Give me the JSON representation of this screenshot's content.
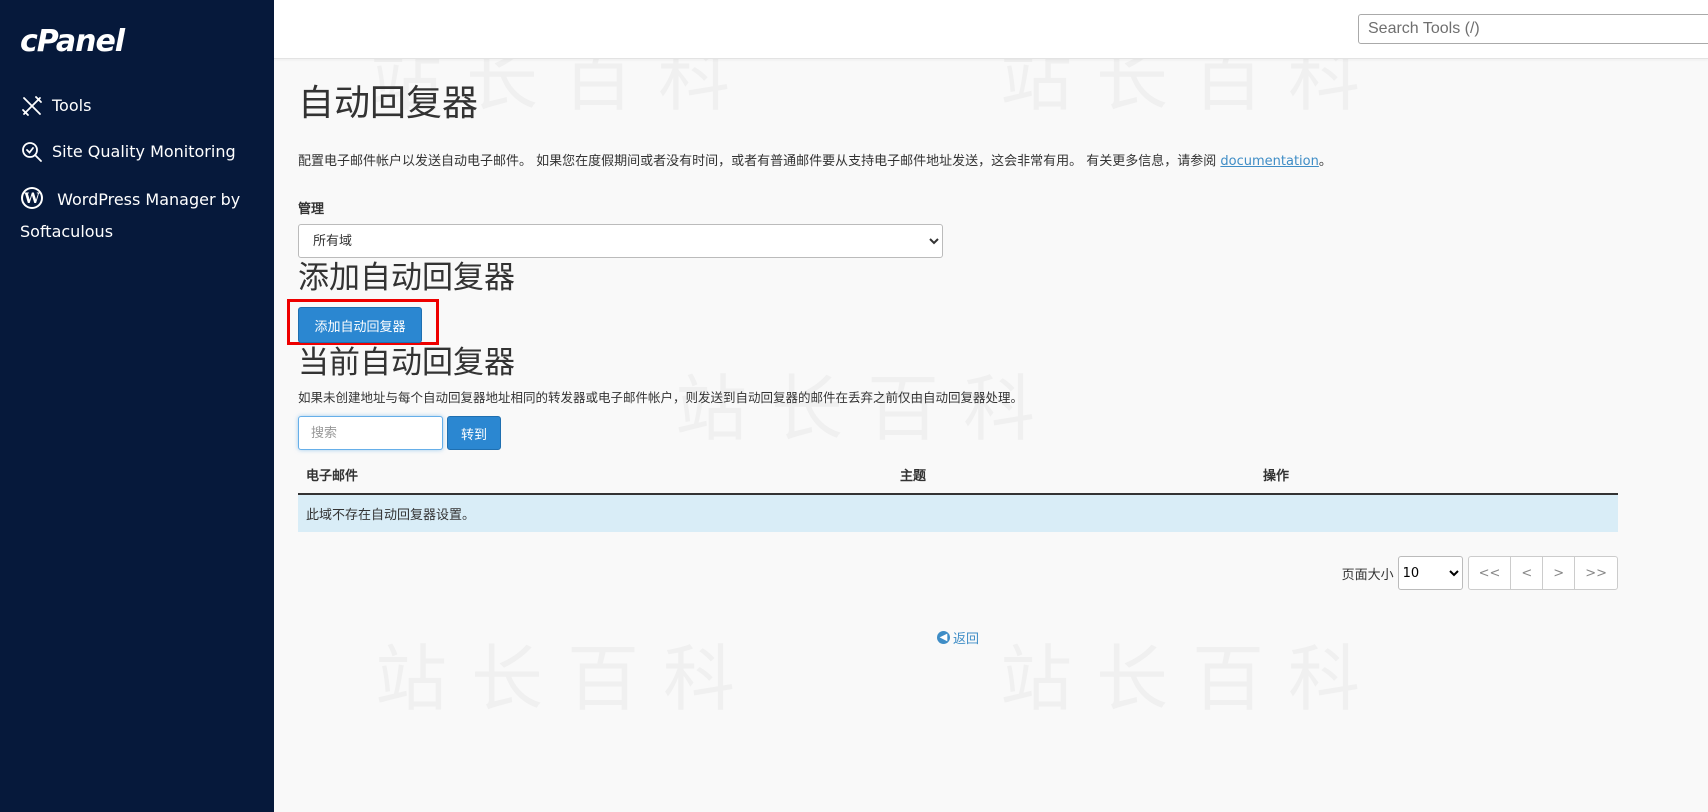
{
  "sidebar": {
    "logo": "cPanel",
    "items": [
      {
        "label": "Tools",
        "icon": "tools-icon"
      },
      {
        "label": "Site Quality Monitoring",
        "icon": "magnifier-check-icon"
      },
      {
        "label": "WordPress Manager by Softaculous",
        "icon": "wordpress-icon"
      }
    ]
  },
  "header": {
    "search_placeholder": "Search Tools (/)"
  },
  "main": {
    "title": "自动回复器",
    "description": "配置电子邮件帐户以发送自动电子邮件。 如果您在度假期间或者没有时间，或者有普通邮件要从支持电子邮件地址发送，这会非常有用。 有关更多信息，请参阅 ",
    "doc_link": "documentation",
    "desc_end": "。",
    "manage_label": "管理",
    "domain_selected": "所有域",
    "add_section_title": "添加自动回复器",
    "add_button": "添加自动回复器",
    "current_section_title": "当前自动回复器",
    "current_note": "如果未创建地址与每个自动回复器地址相同的转发器或电子邮件帐户，则发送到自动回复器的邮件在丢弃之前仅由自动回复器处理。",
    "search_placeholder": "搜索",
    "go_button": "转到",
    "table": {
      "headers": [
        "电子邮件",
        "主题",
        "操作"
      ],
      "empty_message": "此域不存在自动回复器设置。"
    },
    "pager": {
      "label": "页面大小",
      "page_size": "10",
      "buttons": [
        "<<",
        "<",
        ">",
        ">>"
      ]
    },
    "back_link": "返回"
  },
  "watermark": "站长百科",
  "colors": {
    "sidebar_bg": "#06193b",
    "primary_button": "#2b87d1",
    "highlight": "#ee0000",
    "table_info_row": "#d9edf7",
    "link": "#3f8dc6"
  }
}
